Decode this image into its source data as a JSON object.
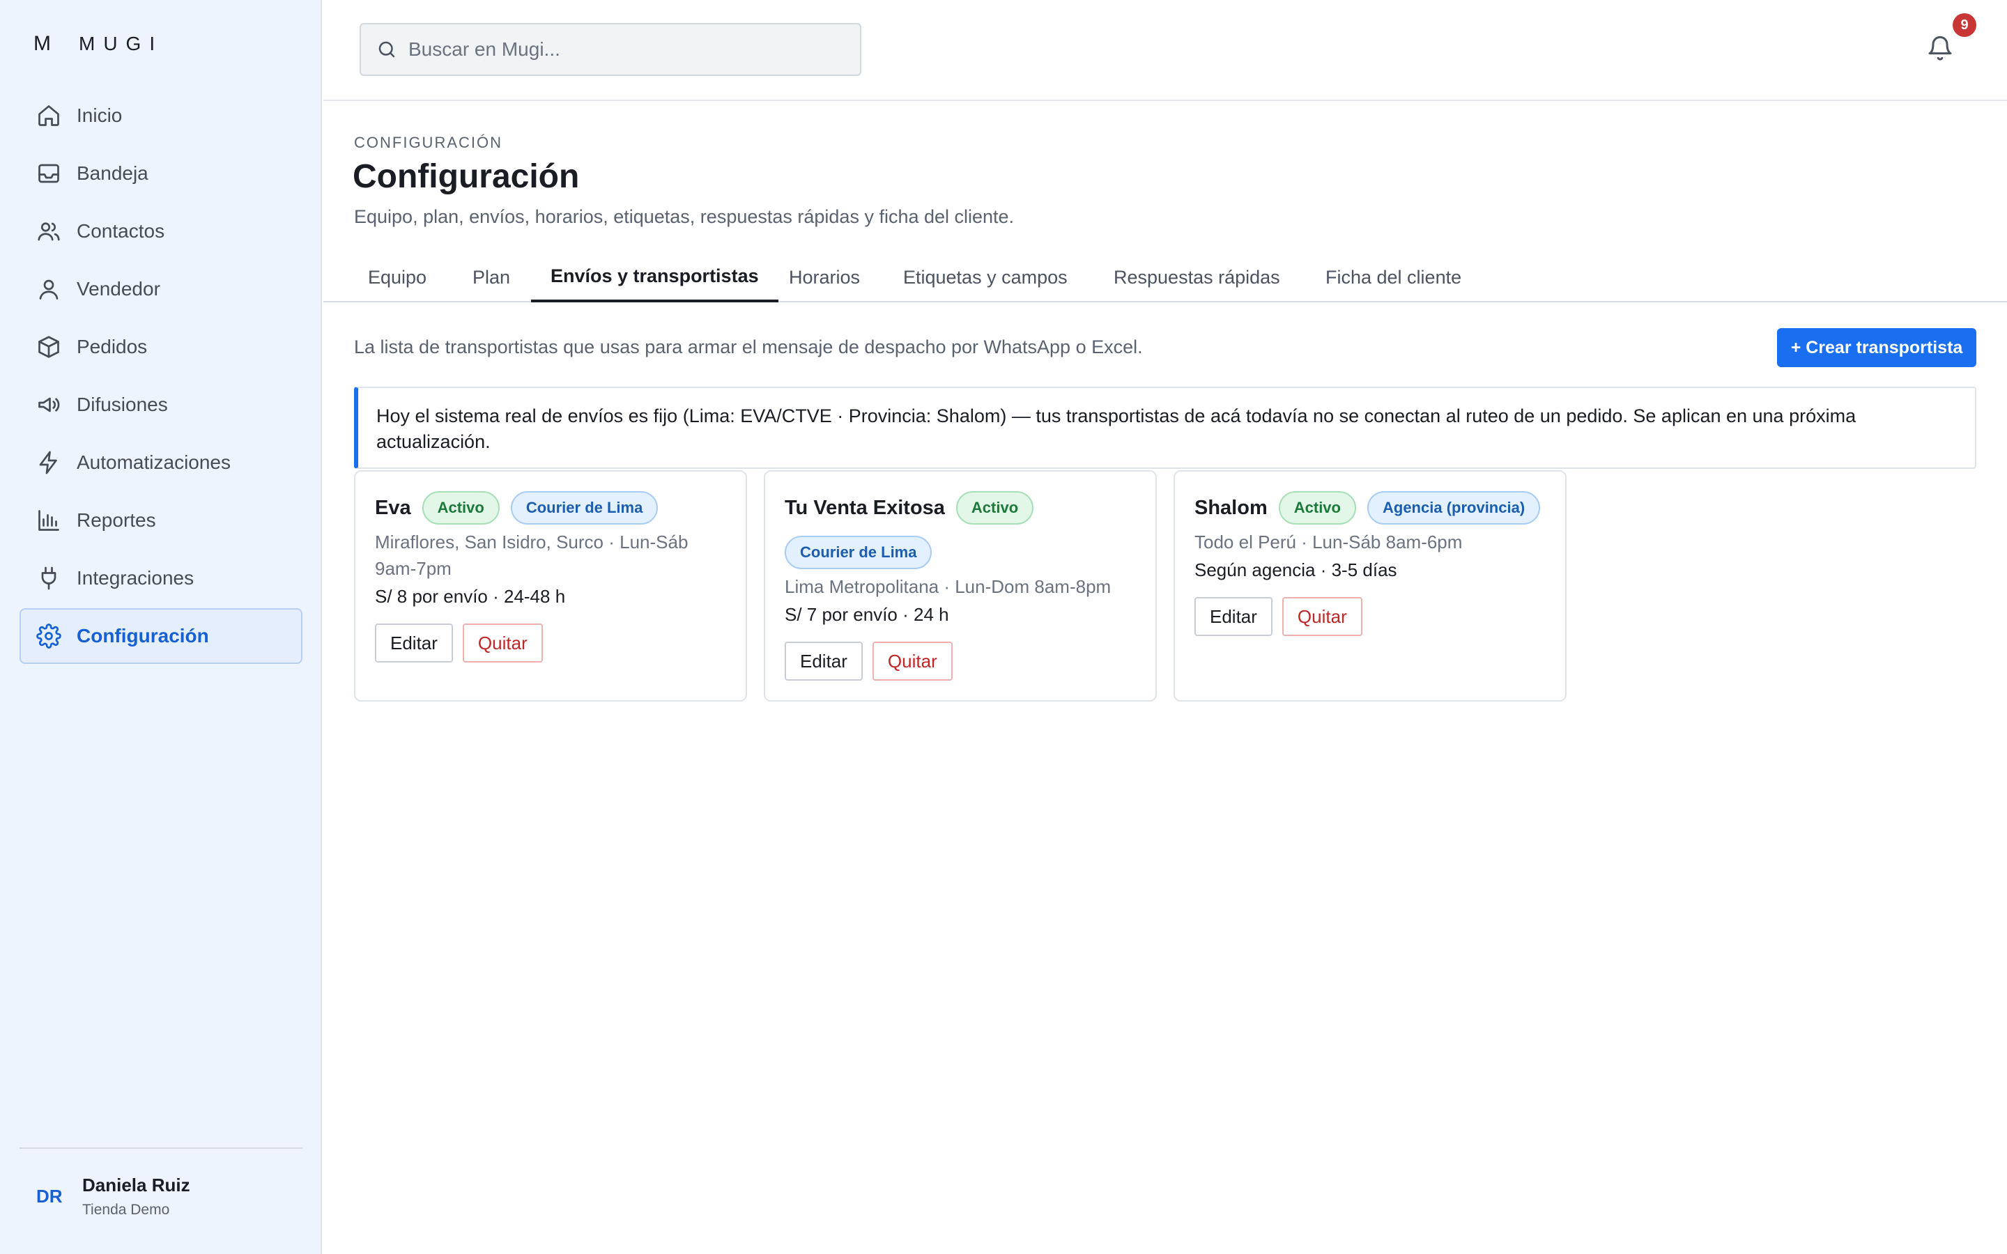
{
  "brand": {
    "mark": "M",
    "name": "MUGI"
  },
  "sidebar": {
    "items": [
      {
        "label": "Inicio",
        "icon": "home-icon"
      },
      {
        "label": "Bandeja",
        "icon": "inbox-icon"
      },
      {
        "label": "Contactos",
        "icon": "users-icon"
      },
      {
        "label": "Vendedor",
        "icon": "user-icon"
      },
      {
        "label": "Pedidos",
        "icon": "box-icon"
      },
      {
        "label": "Difusiones",
        "icon": "megaphone-icon"
      },
      {
        "label": "Automatizaciones",
        "icon": "bolt-icon"
      },
      {
        "label": "Reportes",
        "icon": "bar-chart-icon"
      },
      {
        "label": "Integraciones",
        "icon": "plug-icon"
      },
      {
        "label": "Configuración",
        "icon": "gear-icon",
        "active": true
      }
    ],
    "user": {
      "initials": "DR",
      "name": "Daniela Ruiz",
      "org": "Tienda Demo"
    }
  },
  "topbar": {
    "search_placeholder": "Buscar en Mugi...",
    "notifications_count": "9"
  },
  "header": {
    "kicker": "CONFIGURACIÓN",
    "title": "Configuración",
    "subtitle": "Equipo, plan, envíos, horarios, etiquetas, respuestas rápidas y ficha del cliente."
  },
  "tabs": [
    {
      "label": "Equipo"
    },
    {
      "label": "Plan"
    },
    {
      "label": "Envíos y transportistas",
      "active": true
    },
    {
      "label": "Horarios"
    },
    {
      "label": "Etiquetas y campos"
    },
    {
      "label": "Respuestas rápidas"
    },
    {
      "label": "Ficha del cliente"
    }
  ],
  "shipping": {
    "description": "La lista de transportistas que usas para armar el mensaje de despacho por WhatsApp o Excel.",
    "create_label": "+ Crear transportista",
    "notice": "Hoy el sistema real de envíos es fijo (Lima: EVA/CTVE · Provincia: Shalom) — tus transportistas de acá todavía no se conectan al ruteo de un pedido. Se aplican en una próxima actualización.",
    "carriers": [
      {
        "name": "Eva",
        "status": "Activo",
        "type": "Courier de Lima",
        "coverage": "Miraflores, San Isidro, Surco · Lun-Sáb 9am-7pm",
        "price": "S/ 8 por envío · 24-48 h",
        "edit": "Editar",
        "remove": "Quitar"
      },
      {
        "name": "Tu Venta Exitosa",
        "status": "Activo",
        "type": "Courier de Lima",
        "coverage": "Lima Metropolitana · Lun-Dom 8am-8pm",
        "price": "S/ 7 por envío · 24 h",
        "edit": "Editar",
        "remove": "Quitar"
      },
      {
        "name": "Shalom",
        "status": "Activo",
        "type": "Agencia (provincia)",
        "coverage": "Todo el Perú · Lun-Sáb 8am-6pm",
        "price": "Según agencia · 3-5 días",
        "edit": "Editar",
        "remove": "Quitar"
      }
    ]
  },
  "colors": {
    "accent": "#1a6ef0",
    "active_nav": "#1560d4",
    "danger": "#c02626",
    "badge": "#c93636"
  }
}
